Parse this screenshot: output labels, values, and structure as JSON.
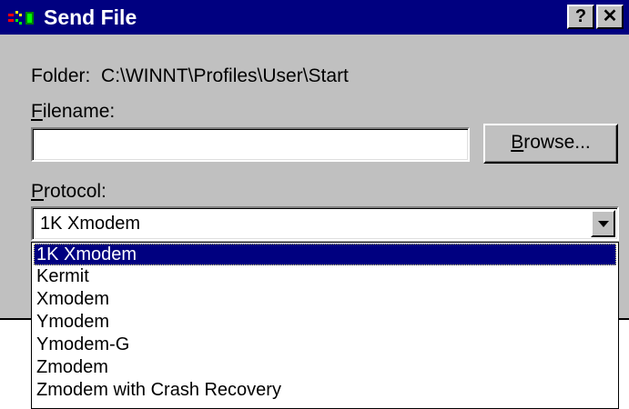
{
  "window": {
    "title": "Send File",
    "help_button": "?",
    "close_button": "✕"
  },
  "folder": {
    "label": "Folder:",
    "path": "C:\\WINNT\\Profiles\\User\\Start"
  },
  "filename": {
    "label_mnemonic": "F",
    "label_rest": "ilename:",
    "value": "",
    "browse_mnemonic": "B",
    "browse_rest": "rowse..."
  },
  "protocol": {
    "label_mnemonic": "P",
    "label_rest": "rotocol:",
    "selected": "1K Xmodem",
    "options": [
      {
        "label": "1K Xmodem",
        "selected": true
      },
      {
        "label": "Kermit",
        "selected": false
      },
      {
        "label": "Xmodem",
        "selected": false
      },
      {
        "label": "Ymodem",
        "selected": false
      },
      {
        "label": "Ymodem-G",
        "selected": false
      },
      {
        "label": "Zmodem",
        "selected": false
      },
      {
        "label": "Zmodem with Crash Recovery",
        "selected": false
      }
    ]
  },
  "colors": {
    "title_bar": "#000080",
    "face": "#c0c0c0",
    "selection": "#000080"
  }
}
